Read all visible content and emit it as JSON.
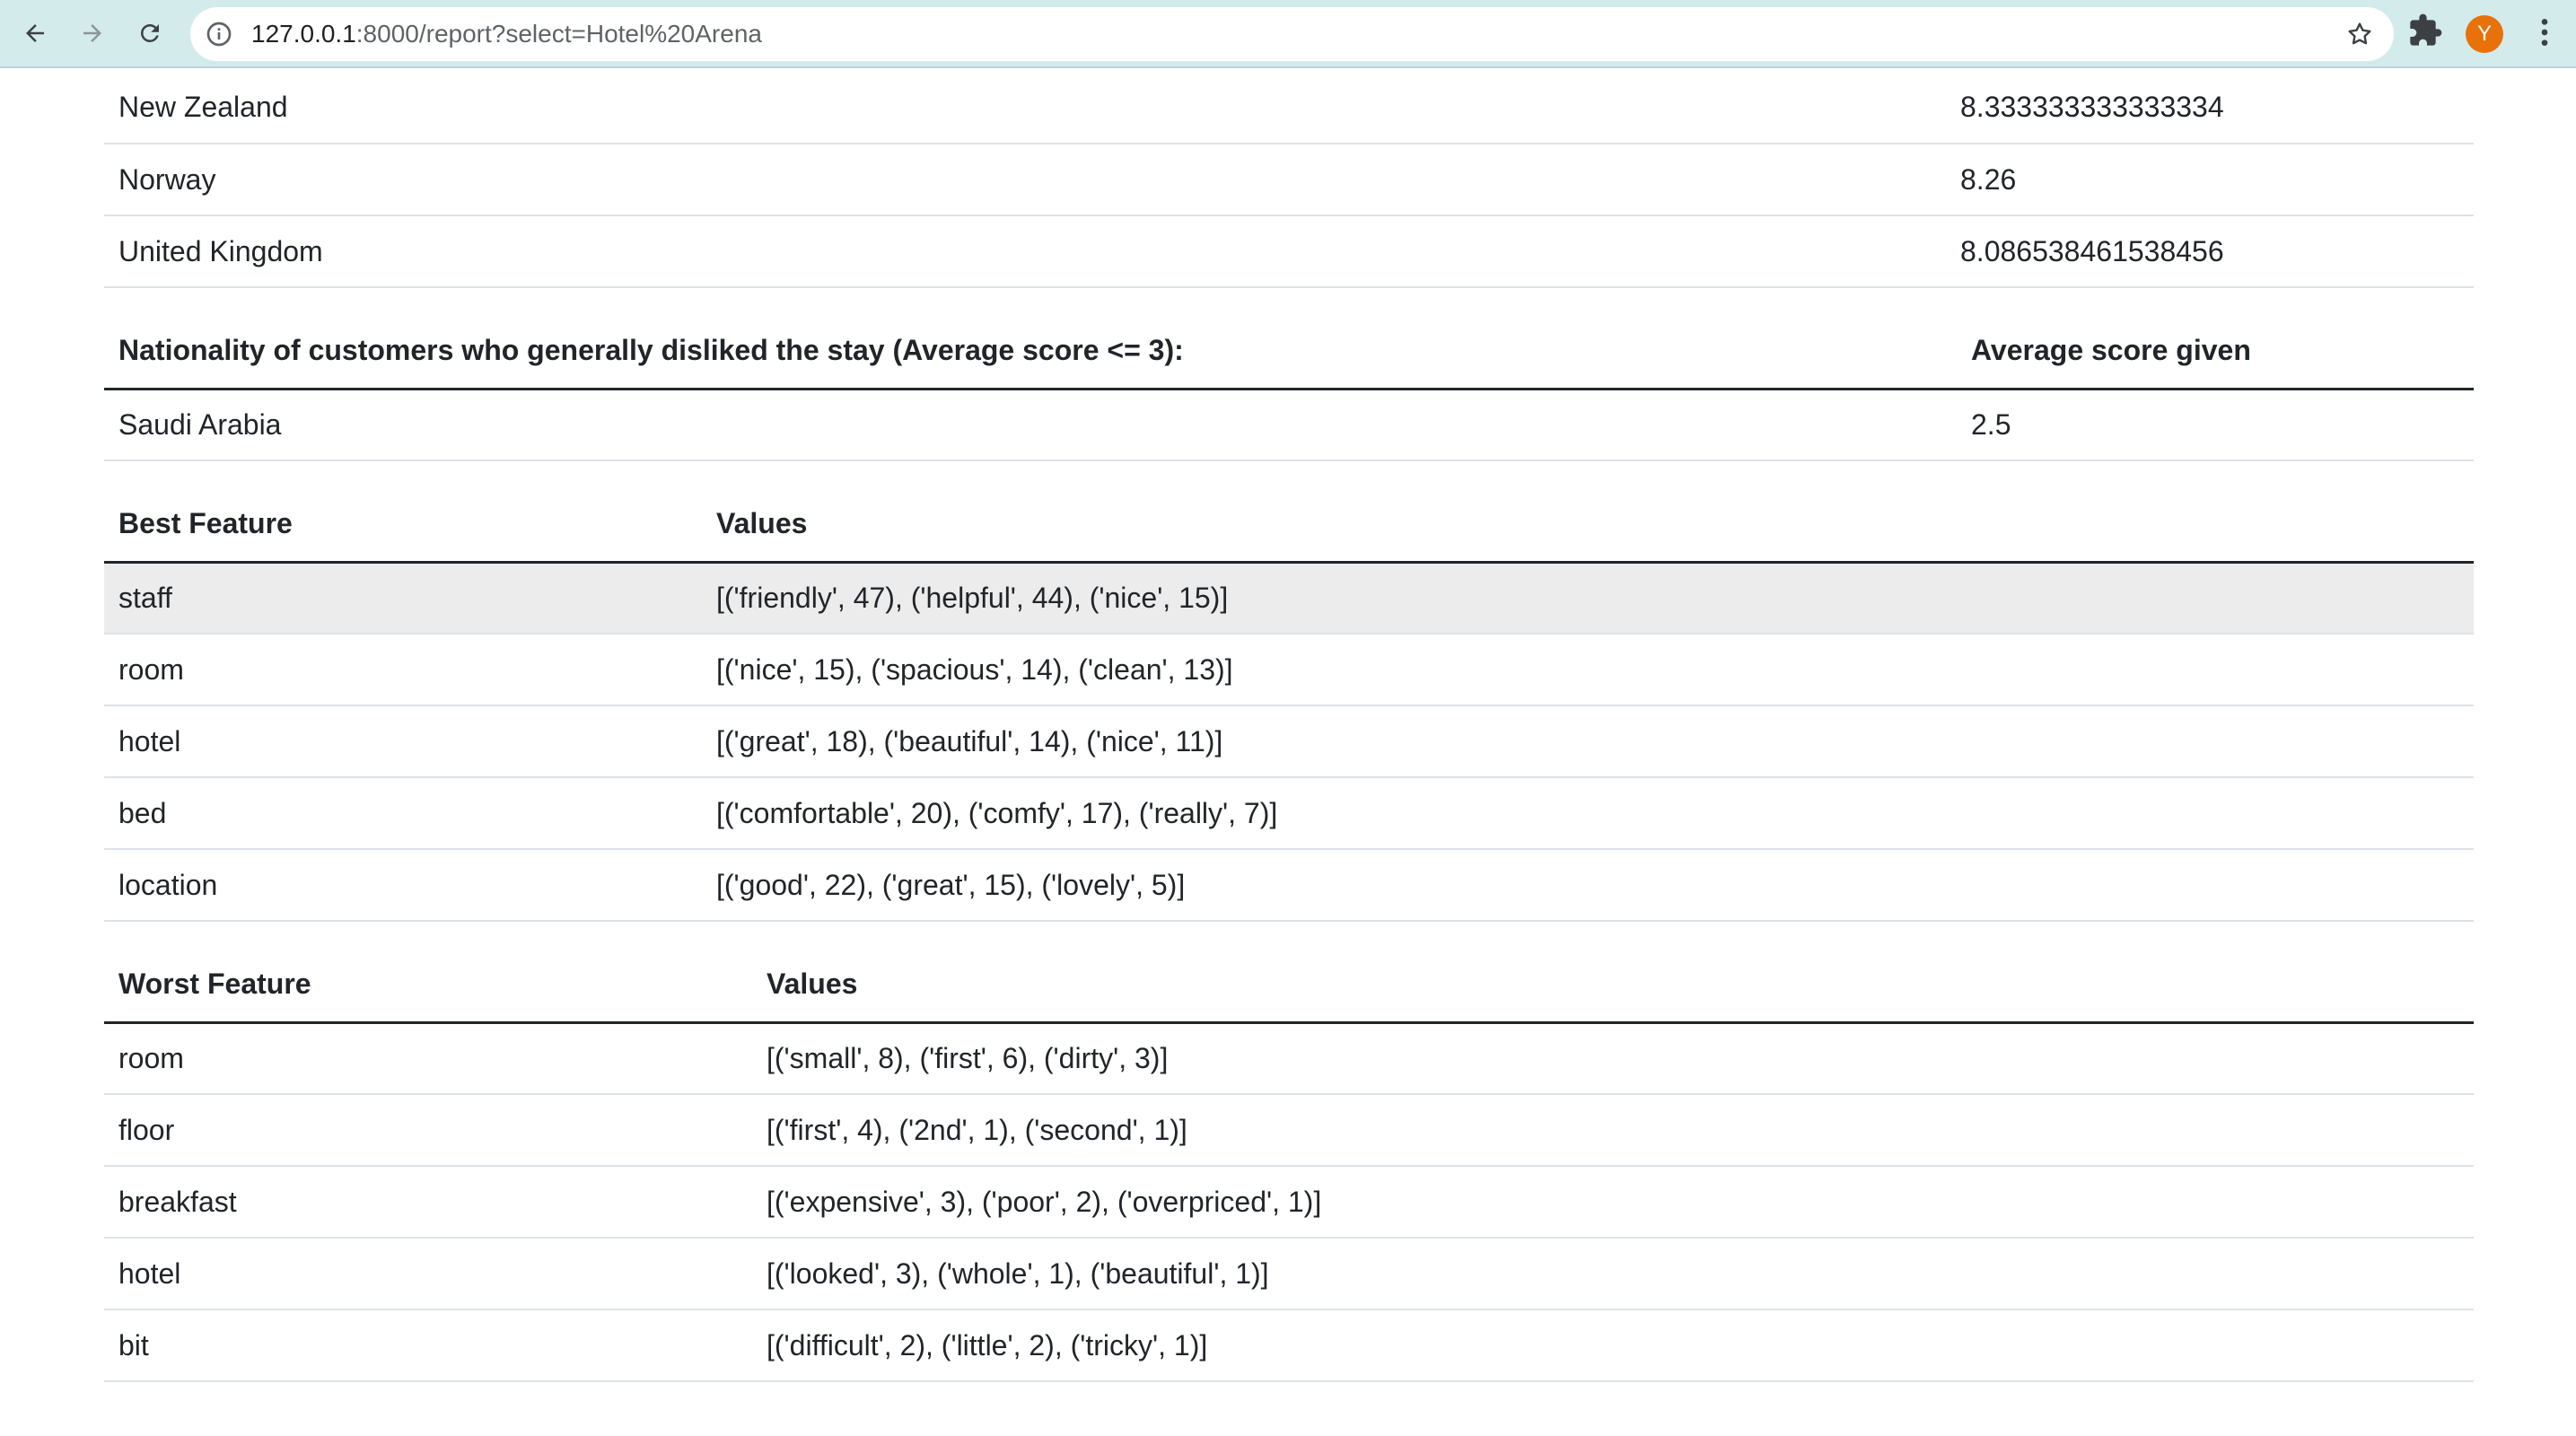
{
  "browser": {
    "url_host": "127.0.0.1",
    "url_rest": ":8000/report?select=Hotel%20Arena",
    "avatar_letter": "Y"
  },
  "top_countries": {
    "rows": [
      {
        "country": "New Zealand",
        "score": "8.333333333333334"
      },
      {
        "country": "Norway",
        "score": "8.26"
      },
      {
        "country": "United Kingdom",
        "score": "8.086538461538456"
      }
    ]
  },
  "disliked": {
    "header_country": "Nationality of customers who generally disliked the stay (Average score <= 3):",
    "header_score": "Average score given",
    "rows": [
      {
        "country": "Saudi Arabia",
        "score": "2.5"
      }
    ]
  },
  "best": {
    "header_feature": "Best Feature",
    "header_values": "Values",
    "rows": [
      {
        "feature": "staff",
        "values": "[('friendly', 47), ('helpful', 44), ('nice', 15)]"
      },
      {
        "feature": "room",
        "values": "[('nice', 15), ('spacious', 14), ('clean', 13)]"
      },
      {
        "feature": "hotel",
        "values": "[('great', 18), ('beautiful', 14), ('nice', 11)]"
      },
      {
        "feature": "bed",
        "values": "[('comfortable', 20), ('comfy', 17), ('really', 7)]"
      },
      {
        "feature": "location",
        "values": "[('good', 22), ('great', 15), ('lovely', 5)]"
      }
    ]
  },
  "worst": {
    "header_feature": "Worst Feature",
    "header_values": "Values",
    "rows": [
      {
        "feature": "room",
        "values": "[('small', 8), ('first', 6), ('dirty', 3)]"
      },
      {
        "feature": "floor",
        "values": "[('first', 4), ('2nd', 1), ('second', 1)]"
      },
      {
        "feature": "breakfast",
        "values": "[('expensive', 3), ('poor', 2), ('overpriced', 1)]"
      },
      {
        "feature": "hotel",
        "values": "[('looked', 3), ('whole', 1), ('beautiful', 1)]"
      },
      {
        "feature": "bit",
        "values": "[('difficult', 2), ('little', 2), ('tricky', 1)]"
      }
    ]
  }
}
